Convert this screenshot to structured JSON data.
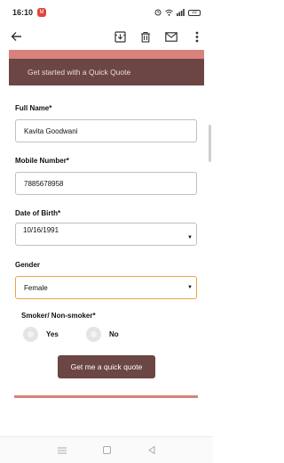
{
  "status_bar": {
    "time": "16:10",
    "battery": "22",
    "notification_badge": "M"
  },
  "banner": {
    "text": "Get started with a Quick Quote"
  },
  "form": {
    "full_name": {
      "label": "Full Name*",
      "value": "Kavita Goodwani"
    },
    "mobile": {
      "label": "Mobile Number*",
      "value": "7885678958"
    },
    "dob": {
      "label": "Date of Birth*",
      "value": "10/16/1991"
    },
    "gender": {
      "label": "Gender",
      "value": "Female"
    },
    "smoker": {
      "label": "Smoker/ Non-smoker*",
      "options": [
        "Yes",
        "No"
      ]
    },
    "submit_label": "Get me a quick quote"
  },
  "colors": {
    "brand_dark": "#6b4644",
    "brand_light": "#d9827d",
    "focus": "#e8a44a"
  },
  "icons": {
    "back": "arrow-left-icon",
    "archive": "archive-icon",
    "delete": "trash-icon",
    "mail": "mail-icon",
    "more": "more-vert-icon"
  }
}
